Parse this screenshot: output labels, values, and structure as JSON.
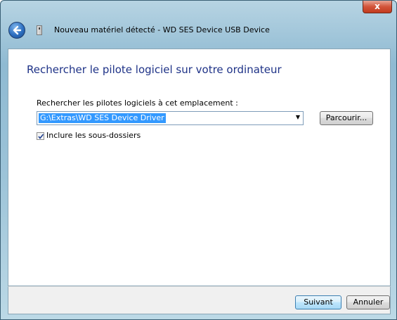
{
  "window": {
    "title": "Nouveau matériel détecté - WD SES Device USB Device",
    "close_label": "x"
  },
  "main": {
    "heading": "Rechercher le pilote logiciel sur votre ordinateur",
    "location_label": "Rechercher les pilotes logiciels à cet emplacement :",
    "location_value": "G:\\Extras\\WD SES Device Driver",
    "browse_label": "Parcourir...",
    "include_subfolders_label": "Inclure les sous-dossiers",
    "include_subfolders_checked": true
  },
  "footer": {
    "next_label": "Suivant",
    "cancel_label": "Annuler"
  },
  "colors": {
    "heading": "#1e3287",
    "selection": "#3399ff",
    "glass": "#9cc3d8"
  },
  "icons": [
    "back-arrow-icon",
    "device-icon",
    "close-icon",
    "dropdown-arrow-icon",
    "checkmark-icon"
  ]
}
